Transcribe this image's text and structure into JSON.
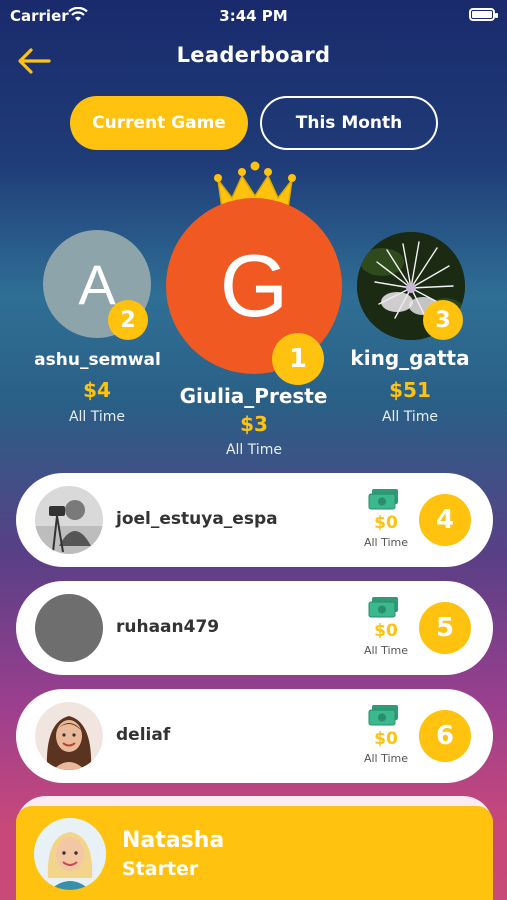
{
  "status_bar": {
    "carrier": "Carrier",
    "time": "3:44 PM"
  },
  "header": {
    "title": "Leaderboard"
  },
  "tabs": [
    {
      "label": "Current Game",
      "active": true
    },
    {
      "label": "This Month",
      "active": false
    }
  ],
  "podium": [
    {
      "rank": "2",
      "initial": "A",
      "name": "ashu_semwal",
      "amount": "$4",
      "period": "All Time"
    },
    {
      "rank": "1",
      "initial": "G",
      "name": "Giulia_Preste",
      "amount": "$3",
      "period": "All Time"
    },
    {
      "rank": "3",
      "initial": "",
      "name": "king_gatta",
      "amount": "$51",
      "period": "All Time"
    }
  ],
  "list": [
    {
      "rank": "4",
      "name": "joel_estuya_espa",
      "amount": "$0",
      "period": "All Time"
    },
    {
      "rank": "5",
      "name": "ruhaan479",
      "amount": "$0",
      "period": "All Time"
    },
    {
      "rank": "6",
      "name": "deliaf",
      "amount": "$0",
      "period": "All Time"
    }
  ],
  "current_user": {
    "name": "Natasha",
    "level": "Starter"
  },
  "colors": {
    "accent": "#ffc20e",
    "rank1_avatar": "#f05a22",
    "rank2_avatar": "#8ea4ab"
  }
}
